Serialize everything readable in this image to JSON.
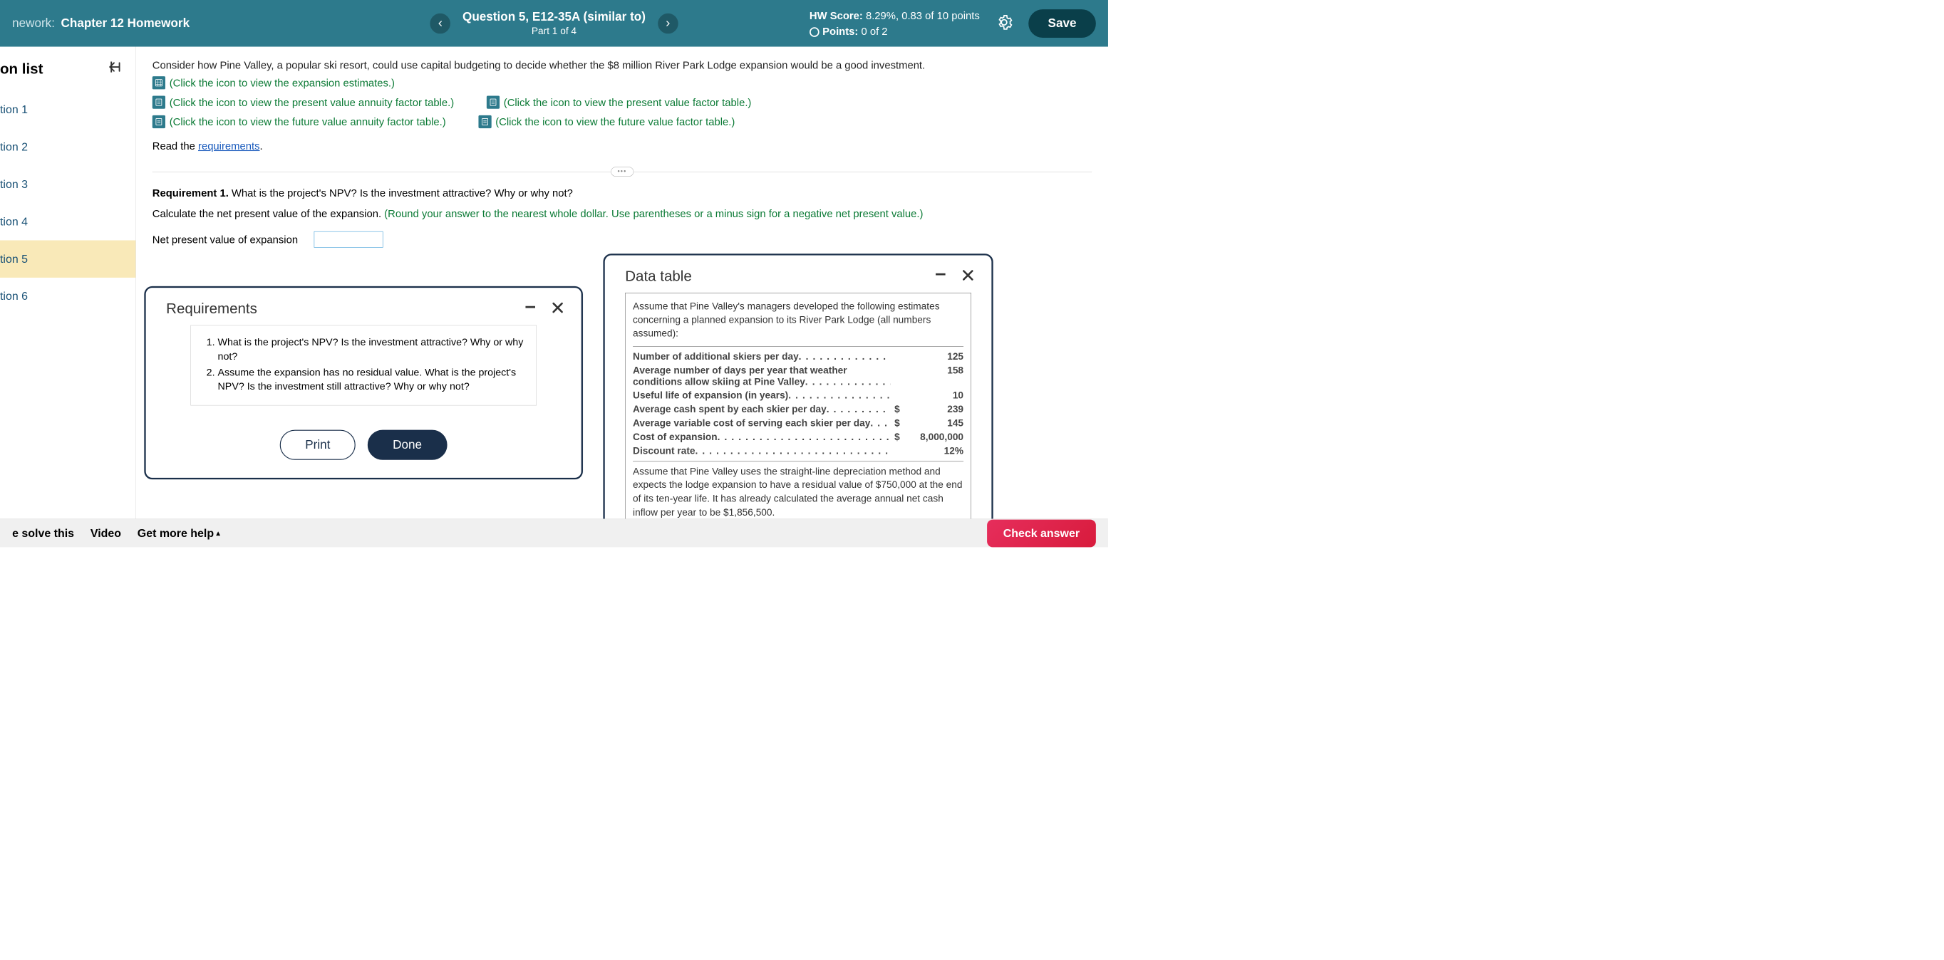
{
  "header": {
    "prefix": "nework:",
    "title": "Chapter 12 Homework",
    "question_title": "Question 5, E12-35A (similar to)",
    "question_part": "Part 1 of 4",
    "hw_score_label": "HW Score:",
    "hw_score_value": "8.29%, 0.83 of 10 points",
    "points_label": "Points:",
    "points_value": "0 of 2",
    "save": "Save"
  },
  "sidebar": {
    "title": "on list",
    "items": [
      "tion 1",
      "tion 2",
      "tion 3",
      "tion 4",
      "tion 5",
      "tion 6"
    ],
    "active_index": 4
  },
  "problem": {
    "intro": "Consider how Pine Valley, a popular ski resort, could use capital budgeting to decide whether the $8 million River Park Lodge expansion would be a good investment.",
    "links": {
      "estimates": "(Click the icon to view the expansion estimates.)",
      "pva": "(Click the icon to view the present value annuity factor table.)",
      "pv": "(Click the icon to view the present value factor table.)",
      "fva": "(Click the icon to view the future value annuity factor table.)",
      "fv": "(Click the icon to view the future value factor table.)"
    },
    "read_prefix": "Read the ",
    "read_link": "requirements",
    "req1_label": "Requirement 1.",
    "req1_text": "What is the project's NPV? Is the investment attractive? Why or why not?",
    "calc_prefix": "Calculate the net present value of the expansion. ",
    "calc_green": "(Round your answer to the nearest whole dollar. Use parentheses or a minus sign for a negative net present value.)",
    "npv_label": "Net present value of expansion"
  },
  "requirements_popup": {
    "title": "Requirements",
    "items": [
      "What is the project's NPV? Is the investment attractive? Why or why not?",
      "Assume the expansion has no residual value. What is the project's NPV? Is the investment still attractive? Why or why not?"
    ],
    "print": "Print",
    "done": "Done"
  },
  "data_popup": {
    "title": "Data table",
    "intro": "Assume that Pine Valley's managers developed the following estimates concerning a planned expansion to its River Park Lodge (all numbers assumed):",
    "rows": [
      {
        "label": "Number of additional skiers per day",
        "curr": "",
        "val": "125"
      },
      {
        "label": "Average number of days per year that weather conditions allow skiing at Pine Valley",
        "curr": "",
        "val": "158"
      },
      {
        "label": "Useful life of expansion (in years)",
        "curr": "",
        "val": "10"
      },
      {
        "label": "Average cash spent by each skier per day",
        "curr": "$",
        "val": "239"
      },
      {
        "label": "Average variable cost of serving each skier per day",
        "curr": "$",
        "val": "145"
      },
      {
        "label": "Cost of expansion",
        "curr": "$",
        "val": "8,000,000"
      },
      {
        "label": "Discount rate",
        "curr": "",
        "val": "12%"
      }
    ],
    "footer": "Assume that Pine Valley uses the straight-line depreciation method and expects the lodge expansion to have a residual value of $750,000 at the end of its ten-year life. It has already calculated the average annual net cash inflow per year to be $1,856,500."
  },
  "bottom": {
    "solve": "e solve this",
    "video": "Video",
    "help": "Get more help",
    "check": "Check answer"
  }
}
